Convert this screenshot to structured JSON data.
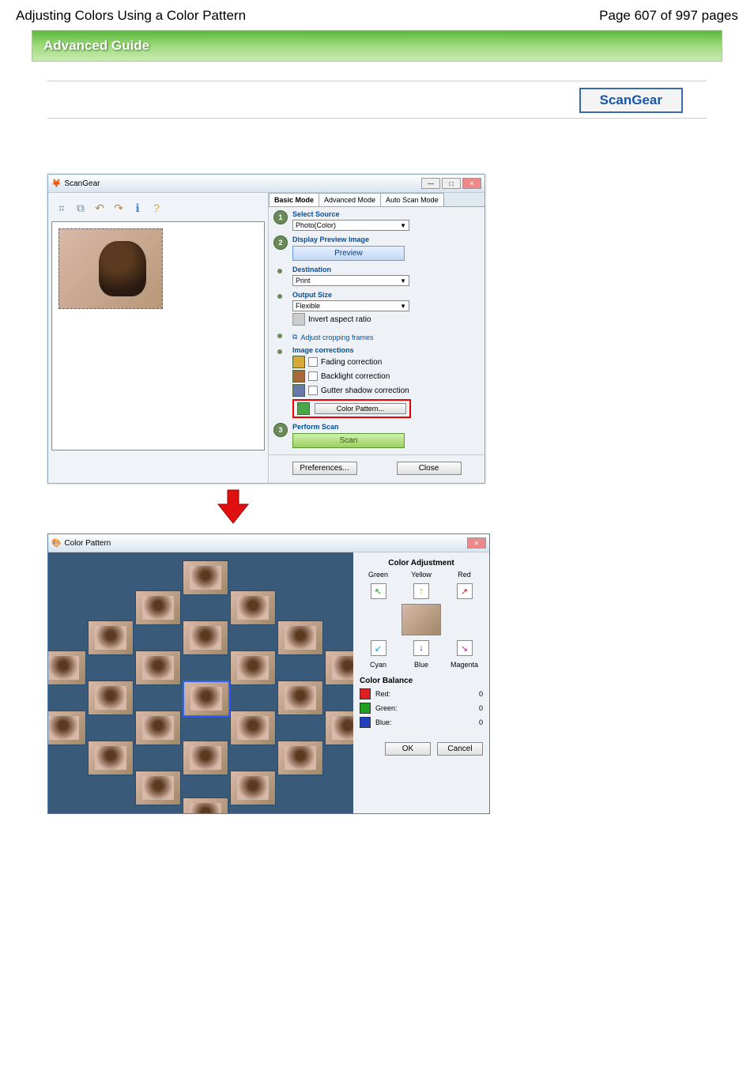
{
  "header": {
    "title": "Adjusting Colors Using a Color Pattern",
    "page_info": "Page 607 of 997 pages"
  },
  "advanced_guide_label": "Advanced Guide",
  "scangear_box_label": "ScanGear",
  "scangear_window": {
    "title": "ScanGear",
    "tabs": {
      "basic": "Basic Mode",
      "advanced": "Advanced Mode",
      "auto": "Auto Scan Mode"
    },
    "step1": {
      "label": "Select Source",
      "value": "Photo(Color)"
    },
    "step2": {
      "label": "Display Preview Image",
      "button": "Preview"
    },
    "destination": {
      "label": "Destination",
      "value": "Print"
    },
    "output_size": {
      "label": "Output Size",
      "value": "Flexible",
      "invert": "Invert aspect ratio"
    },
    "adjust_crop": "Adjust cropping frames",
    "image_corrections": {
      "label": "Image corrections",
      "fading": "Fading correction",
      "backlight": "Backlight correction",
      "gutter": "Gutter shadow correction",
      "color_pattern": "Color Pattern..."
    },
    "perform_scan": {
      "label": "Perform Scan",
      "button": "Scan"
    },
    "footer": {
      "preferences": "Preferences...",
      "close": "Close"
    }
  },
  "color_pattern_window": {
    "title": "Color Pattern",
    "color_adjustment": {
      "title": "Color Adjustment",
      "green": "Green",
      "yellow": "Yellow",
      "red": "Red",
      "cyan": "Cyan",
      "blue": "Blue",
      "magenta": "Magenta"
    },
    "color_balance": {
      "title": "Color Balance",
      "red_label": "Red:",
      "red_value": "0",
      "green_label": "Green:",
      "green_value": "0",
      "blue_label": "Blue:",
      "blue_value": "0"
    },
    "ok": "OK",
    "cancel": "Cancel"
  }
}
